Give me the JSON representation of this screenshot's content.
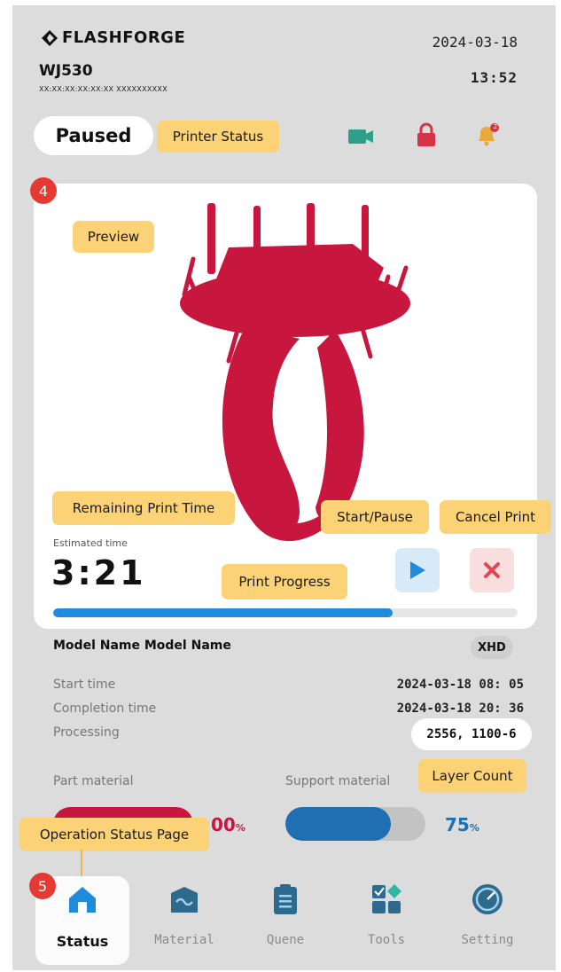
{
  "header": {
    "brand": "FLASHFORGE",
    "model": "WJ530",
    "serial": "XX:XX:XX:XX:XX:XX  XXXXXXXXXX",
    "date": "2024-03-18",
    "time": "13:52"
  },
  "status": {
    "state": "Paused",
    "alert_count": "2"
  },
  "preview": {
    "estimated_label": "Estimated time",
    "estimated_value": "3:21",
    "progress_fraction": 0.73
  },
  "info": {
    "model_name": "Model Name Model Name",
    "quality": "XHD",
    "start_label": "Start time",
    "start_value": "2024-03-18 08: 05",
    "completion_label": "Completion time",
    "completion_value": "2024-03-18 20: 36",
    "processing_label": "Processing",
    "processing_value": "2556, 1100-6"
  },
  "materials": {
    "part_label": "Part material",
    "part_value": "00",
    "part_percent_sign": "%",
    "part_color": "#c8173f",
    "support_label": "Support material",
    "support_value": "75",
    "support_percent_sign": "%",
    "support_fraction": 0.75,
    "support_color": "#1f6fb2"
  },
  "nav": [
    {
      "label": "Status",
      "icon": "home-icon"
    },
    {
      "label": "Material",
      "icon": "material-icon"
    },
    {
      "label": "Quene",
      "icon": "queue-icon"
    },
    {
      "label": "Tools",
      "icon": "tools-icon"
    },
    {
      "label": "Setting",
      "icon": "setting-icon"
    }
  ],
  "annotations": {
    "printer_status": "Printer Status",
    "preview": "Preview",
    "remaining_time": "Remaining Print Time",
    "start_pause": "Start/Pause",
    "cancel_print": "Cancel Print",
    "print_progress": "Print Progress",
    "layer_count": "Layer Count",
    "operation_status_page": "Operation Status Page",
    "badge_4": "4",
    "badge_5": "5"
  }
}
